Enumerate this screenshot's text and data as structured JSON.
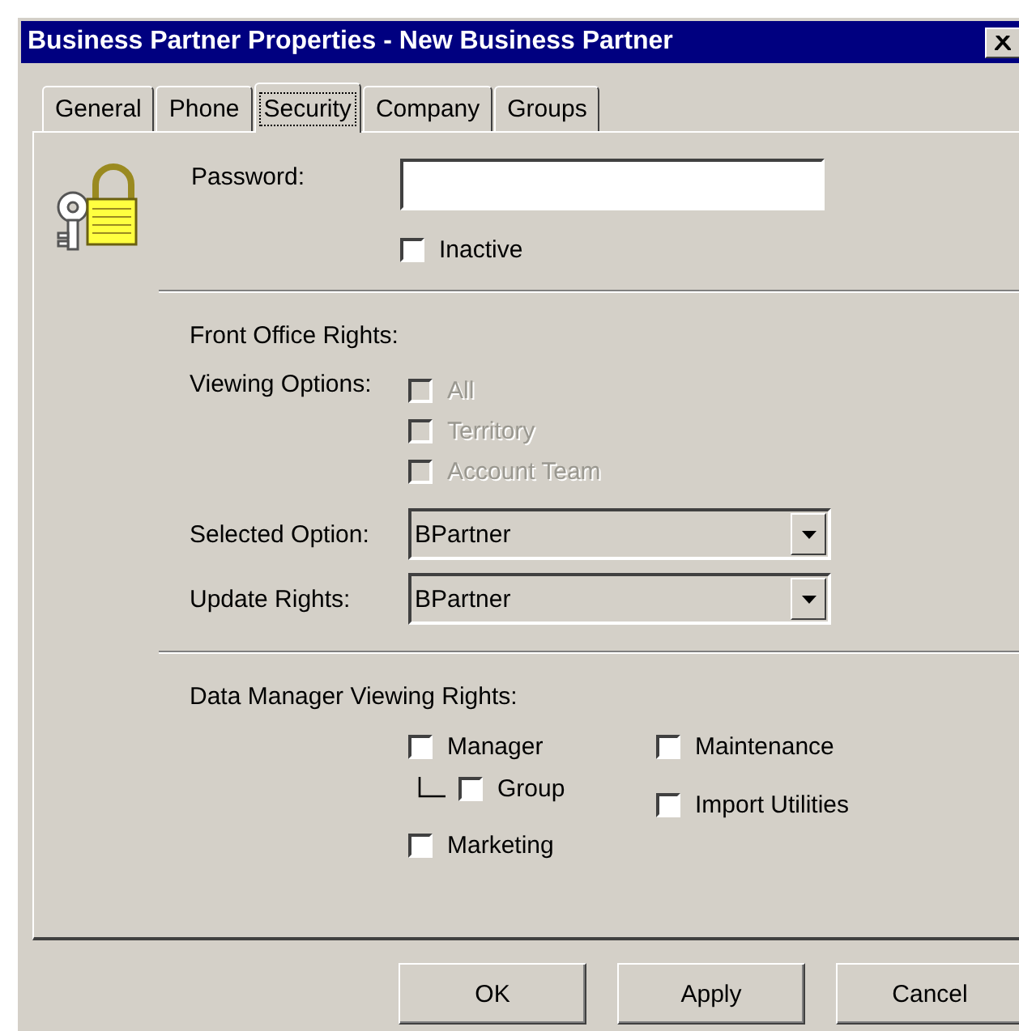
{
  "window": {
    "title": "Business Partner Properties - New Business Partner"
  },
  "tabs": [
    {
      "label": "General",
      "selected": false
    },
    {
      "label": "Phone",
      "selected": false
    },
    {
      "label": "Security",
      "selected": true
    },
    {
      "label": "Company",
      "selected": false
    },
    {
      "label": "Groups",
      "selected": false
    }
  ],
  "password": {
    "label": "Password:"
  },
  "inactive": {
    "label": "Inactive",
    "checked": false
  },
  "front_office": {
    "heading": "Front Office Rights:",
    "viewing_options": {
      "label": "Viewing Options:",
      "options": [
        {
          "label": "All",
          "checked": false,
          "disabled": true
        },
        {
          "label": "Territory",
          "checked": false,
          "disabled": true
        },
        {
          "label": "Account Team",
          "checked": false,
          "disabled": true
        }
      ]
    },
    "selects": [
      {
        "label": "Selected Option:",
        "value": "BPartner"
      },
      {
        "label": "Update Rights:",
        "value": "BPartner"
      }
    ]
  },
  "data_manager": {
    "heading": "Data Manager Viewing Rights:",
    "columns": [
      {
        "items": [
          {
            "label": "Manager",
            "checked": false,
            "children": [
              {
                "label": "Group",
                "checked": false
              }
            ]
          },
          {
            "label": "Marketing",
            "checked": false
          }
        ]
      },
      {
        "items": [
          {
            "label": "Maintenance",
            "checked": false
          },
          {
            "label": "Import Utilities",
            "checked": false
          }
        ]
      }
    ]
  },
  "buttons": [
    "OK",
    "Apply",
    "Cancel"
  ]
}
